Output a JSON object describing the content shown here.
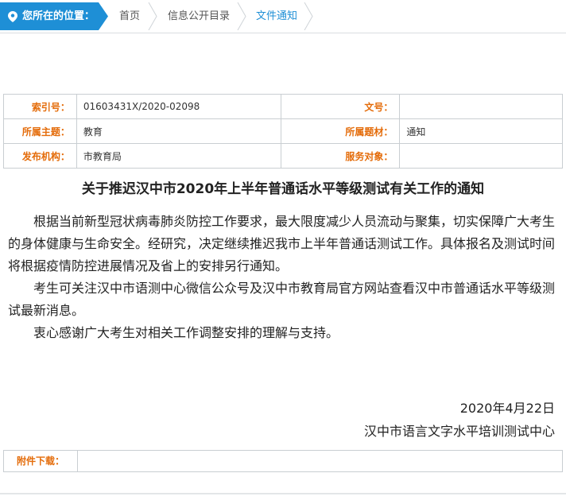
{
  "breadcrumb": {
    "location_label": "您所在的位置：",
    "items": [
      "首页",
      "信息公开目录",
      "文件通知"
    ]
  },
  "meta": {
    "index_label": "索引号：",
    "index_value": "01603431X/2020-02098",
    "docno_label": "文号：",
    "docno_value": "",
    "topic_label": "所属主题：",
    "topic_value": "教育",
    "category_label": "所属题材：",
    "category_value": "通知",
    "org_label": "发布机构：",
    "org_value": "市教育局",
    "target_label": "服务对象：",
    "target_value": ""
  },
  "article": {
    "title": "关于推迟汉中市2020年上半年普通话水平等级测试有关工作的通知",
    "paragraphs": [
      "根据当前新型冠状病毒肺炎防控工作要求，最大限度减少人员流动与聚集，切实保障广大考生的身体健康与生命安全。经研究，决定继续推迟我市上半年普通话测试工作。具体报名及测试时间将根据疫情防控进展情况及省上的安排另行通知。",
      "考生可关注汉中市语测中心微信公众号及汉中市教育局官方网站查看汉中市普通话水平等级测试最新消息。",
      "衷心感谢广大考生对相关工作调整安排的理解与支持。"
    ],
    "date": "2020年4月22日",
    "signer": "汉中市语言文字水平培训测试中心"
  },
  "attachment": {
    "label": "附件下载："
  },
  "colors": {
    "accent": "#1e8fd6",
    "label": "#e46c0a",
    "border": "#c9ced2"
  }
}
